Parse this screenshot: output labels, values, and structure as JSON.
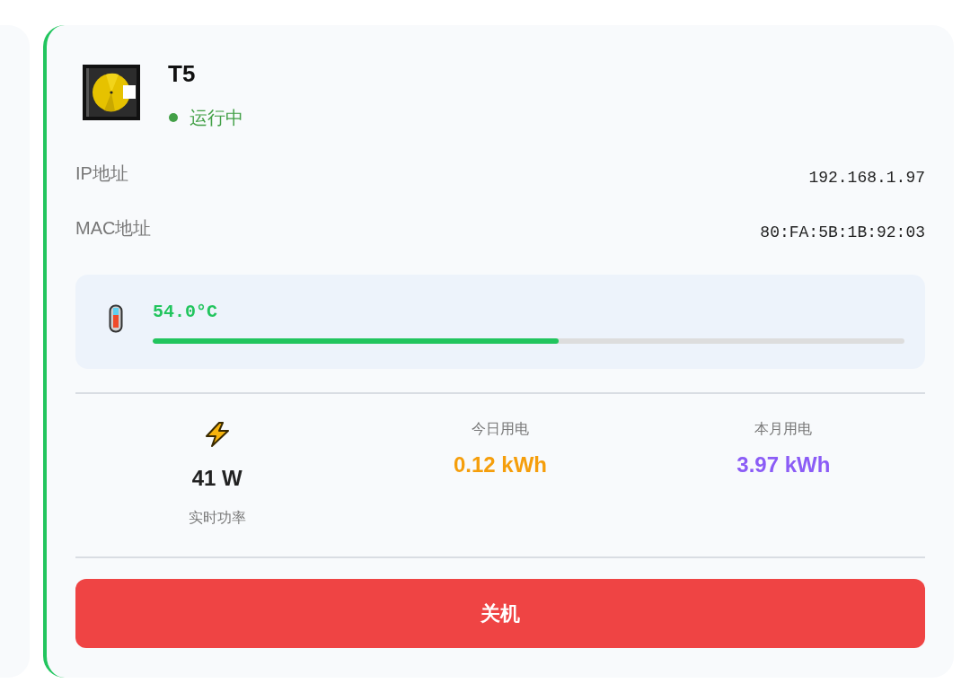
{
  "device": {
    "name": "T5",
    "status": "运行中",
    "running": true
  },
  "info_rows": [
    {
      "label": "IP地址",
      "value": "192.168.1.97"
    },
    {
      "label": "MAC地址",
      "value": "80:FA:5B:1B:92:03"
    }
  ],
  "temperature": {
    "reading": "54.0°C",
    "level": 0.54
  },
  "stats": [
    {
      "kind": "power",
      "value": "41 W",
      "label": "实时功率",
      "color": "#222222"
    },
    {
      "kind": "energy",
      "label": "今日用电",
      "value": "0.12 kWh",
      "color": "#f59e0b"
    },
    {
      "kind": "energy",
      "label": "本月用电",
      "value": "3.97 kWh",
      "color": "#8b5cf6"
    }
  ],
  "power_button": {
    "label": "关机"
  }
}
